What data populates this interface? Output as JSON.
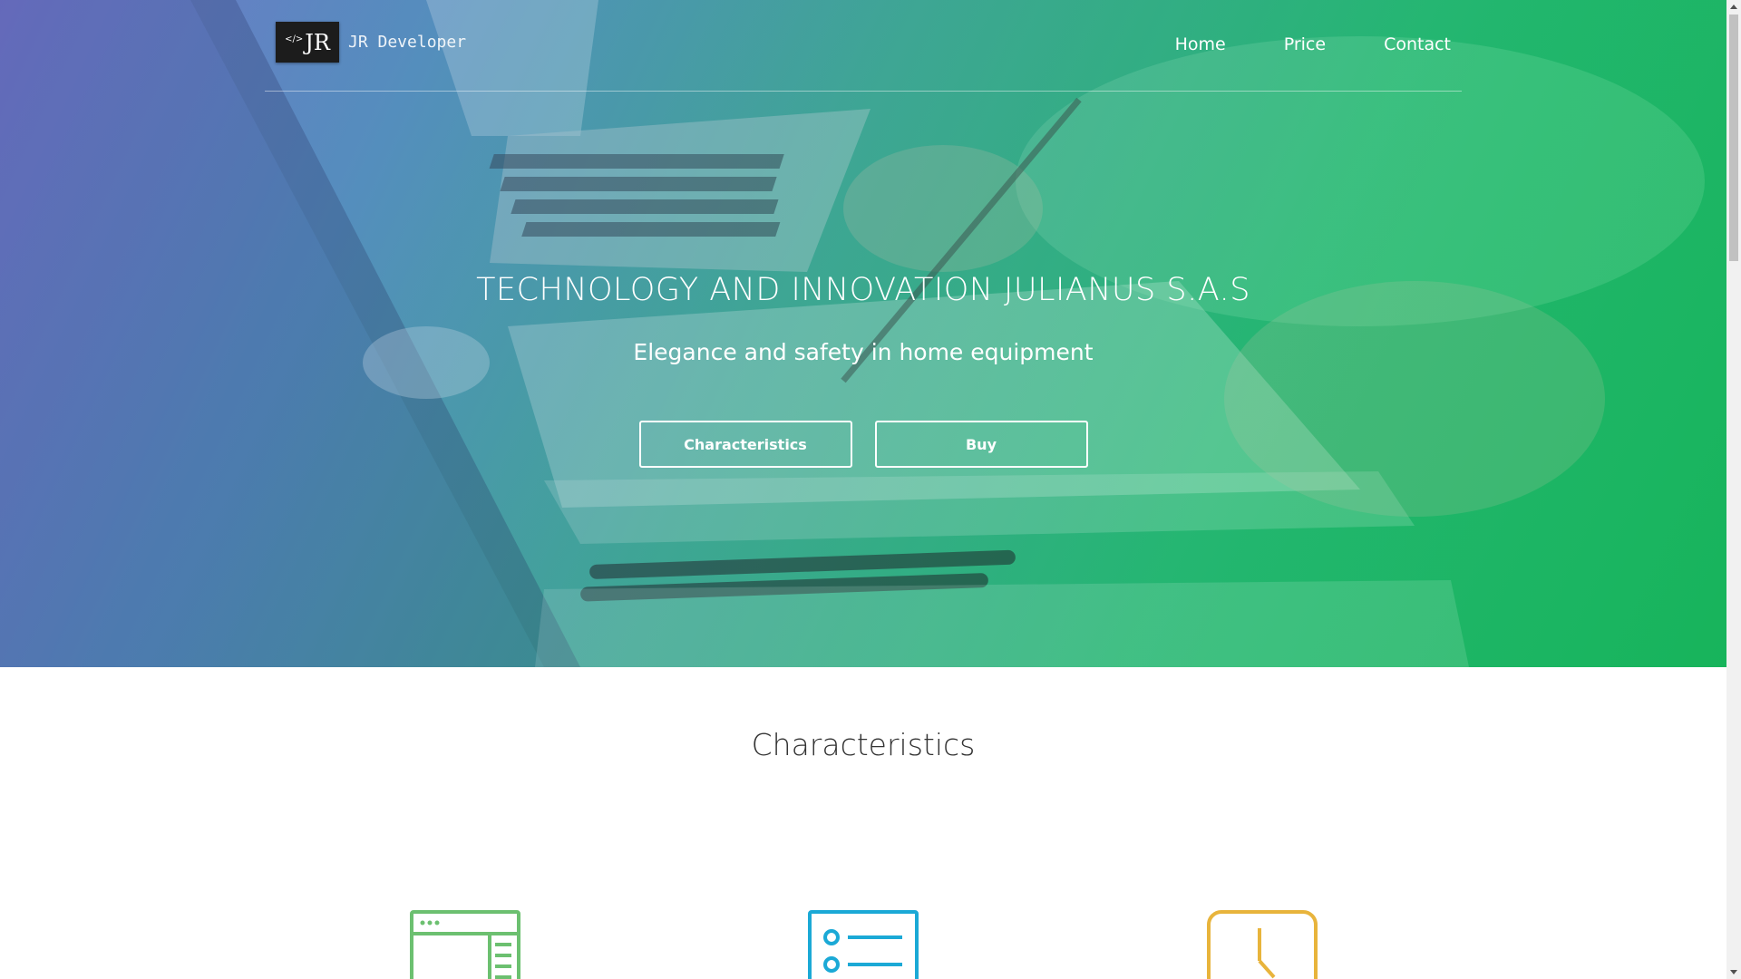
{
  "brand": {
    "logo_tag": "</>",
    "logo_text": "JR",
    "name": "JR Developer"
  },
  "nav": {
    "items": [
      {
        "label": "Home"
      },
      {
        "label": "Price"
      },
      {
        "label": "Contact"
      }
    ]
  },
  "hero": {
    "title": "TECHNOLOGY AND INNOVATION JULIANUS S.A.S",
    "subtitle": "Elegance and safety in home equipment",
    "buttons": {
      "characteristics": "Characteristics",
      "buy": "Buy"
    }
  },
  "characteristics": {
    "title": "Characteristics",
    "icons": [
      {
        "name": "browser-window-icon",
        "color": "#6cc070"
      },
      {
        "name": "list-icon",
        "color": "#1ba9d6"
      },
      {
        "name": "clock-icon",
        "color": "#e8b43c"
      }
    ]
  },
  "colors": {
    "hero_gradient_start": "#6f73c9",
    "hero_gradient_end": "#11b257",
    "text_light": "#ffffff",
    "text_dark": "#333333"
  }
}
